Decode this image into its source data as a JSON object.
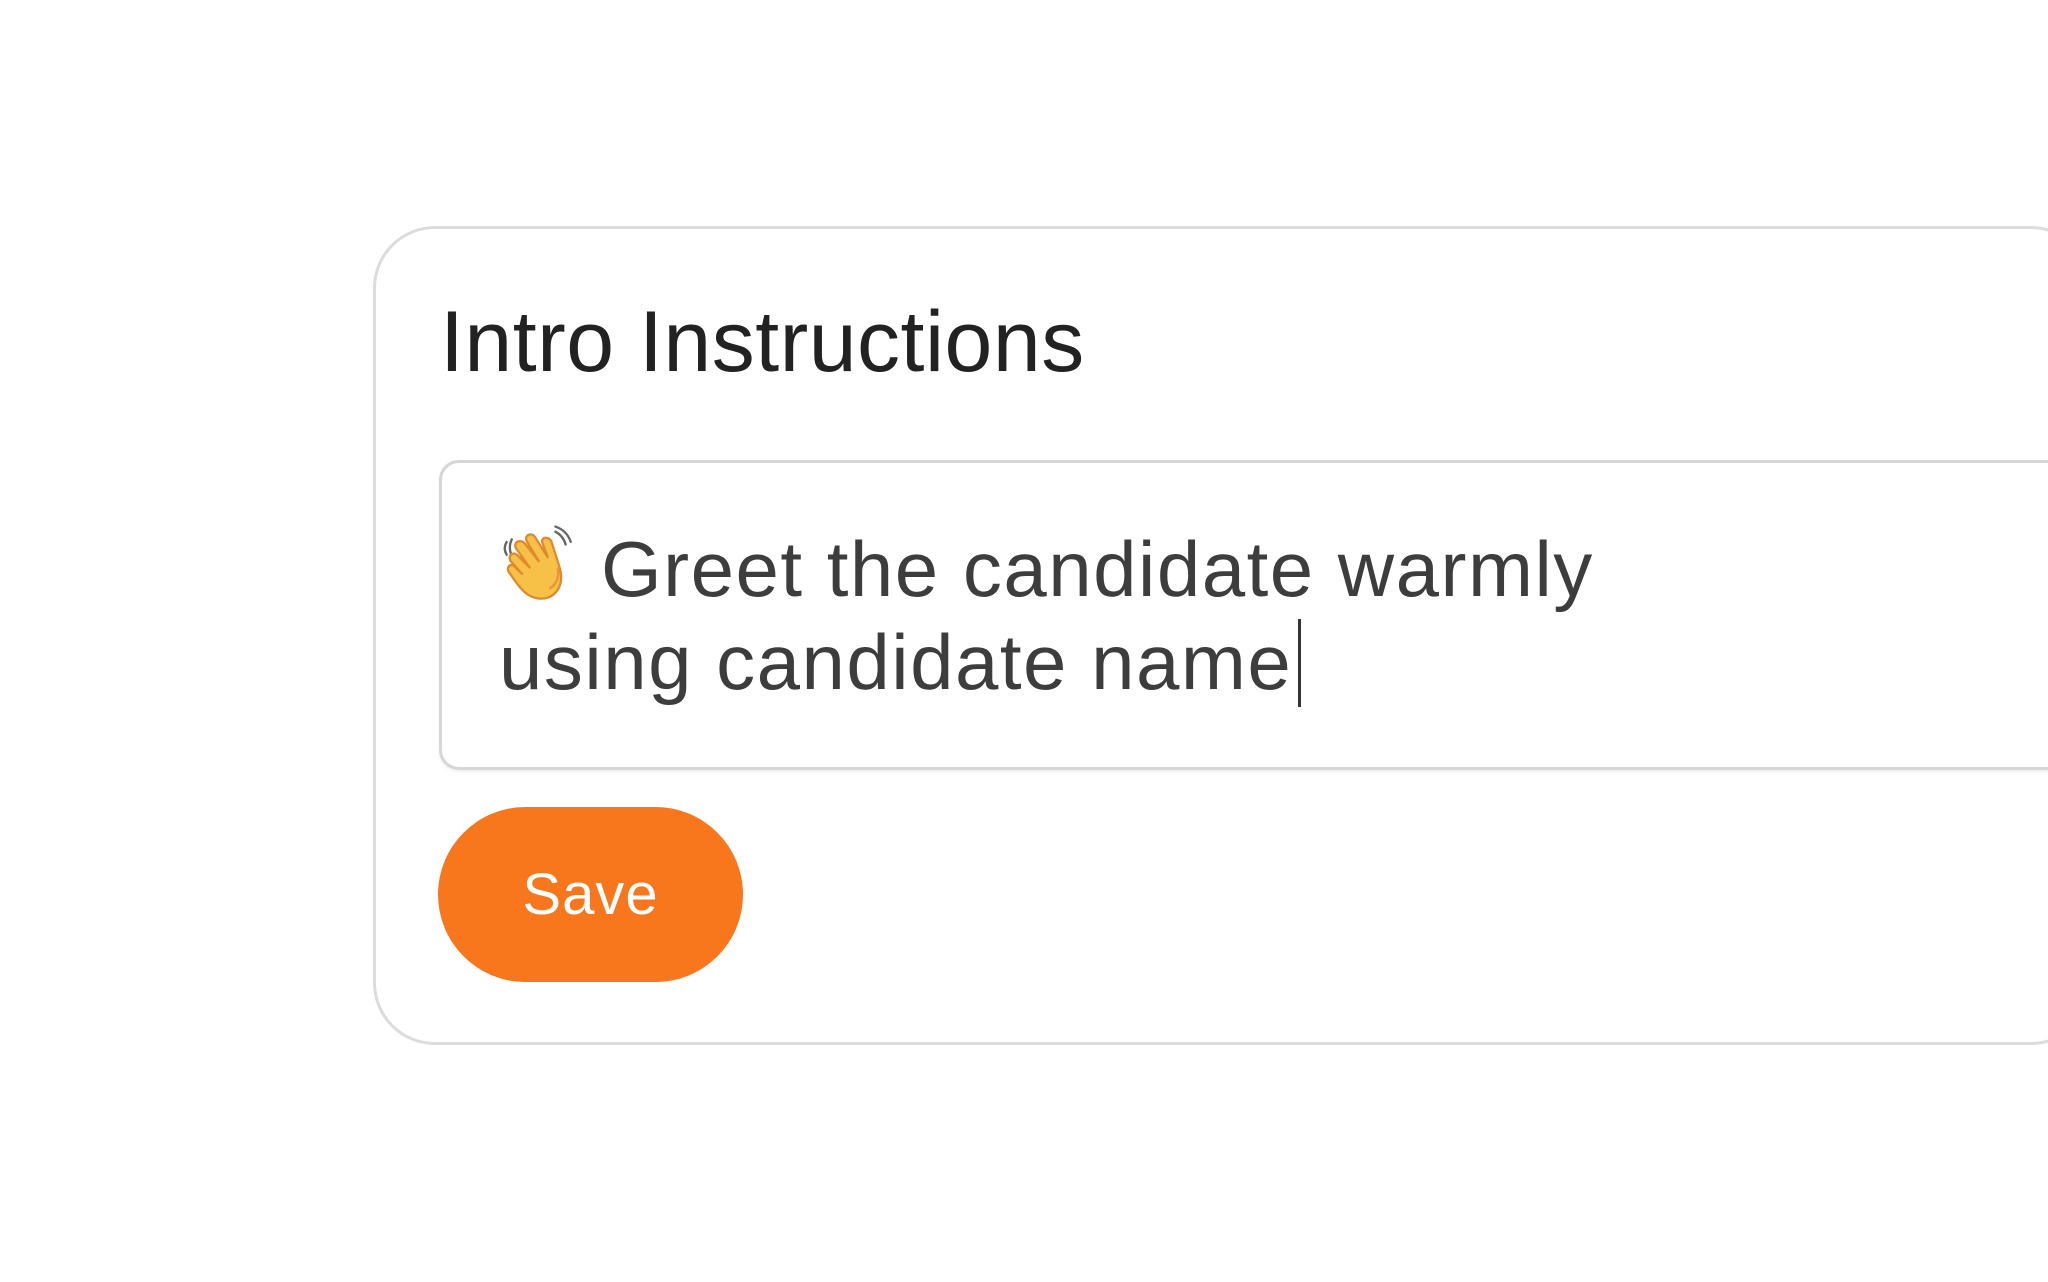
{
  "panel": {
    "title": "Intro Instructions",
    "instructions": {
      "line1": "Greet the candidate warmly",
      "line2": "using candidate name",
      "leading_icon": "waving-hand-icon"
    },
    "save_label": "Save"
  },
  "colors": {
    "accent": "#f8761c",
    "title_text": "#222222",
    "body_text": "#3d3d3d",
    "border": "#dcdcdc"
  }
}
